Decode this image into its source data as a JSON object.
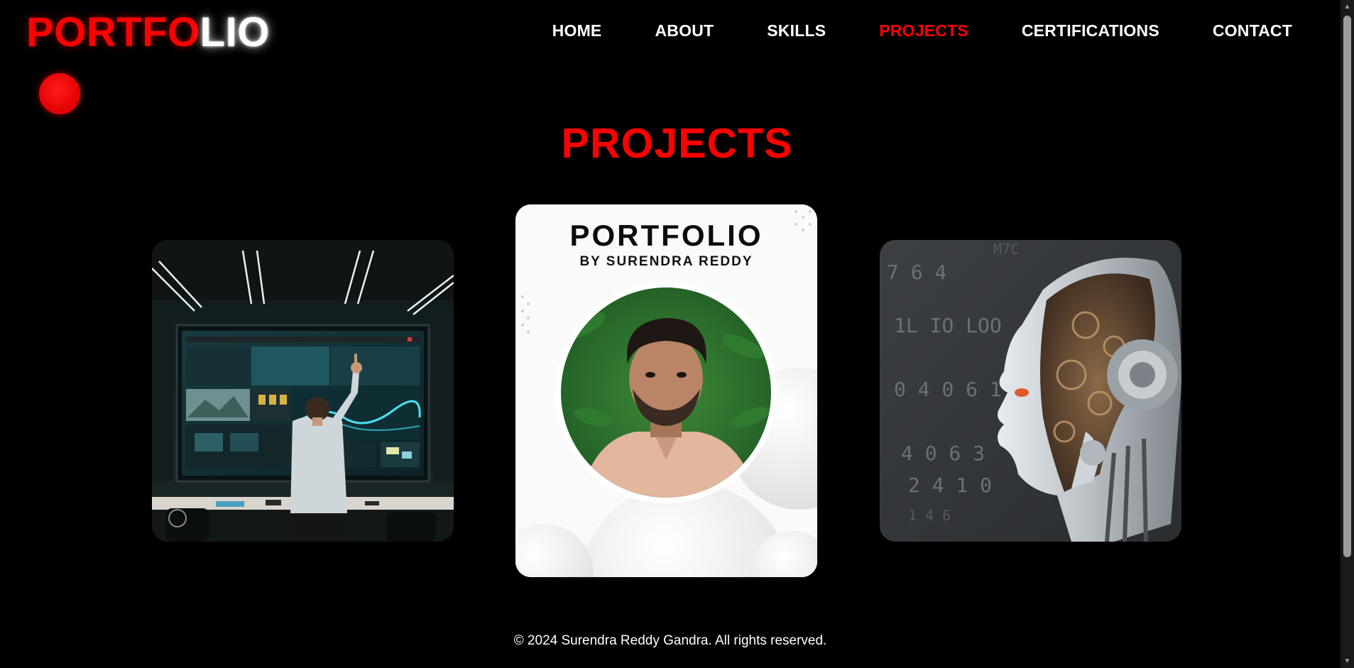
{
  "header": {
    "logo_red": "PORTFO",
    "logo_white": "LIO",
    "nav": [
      {
        "label": "HOME",
        "active": false
      },
      {
        "label": "ABOUT",
        "active": false
      },
      {
        "label": "SKILLS",
        "active": false
      },
      {
        "label": "PROJECTS",
        "active": true
      },
      {
        "label": "CERTIFICATIONS",
        "active": false
      },
      {
        "label": "CONTACT",
        "active": false
      }
    ]
  },
  "main": {
    "title": "PROJECTS",
    "cards": [
      {
        "image": "person at large analytics screen photo"
      },
      {
        "image": "portfolio cover photo",
        "title": "PORTFOLIO",
        "subtitle": "BY SURENDRA REDDY"
      },
      {
        "image": "robot head profile photo"
      }
    ]
  },
  "footer": {
    "text": "© 2024 Surendra Reddy Gandra. All rights reserved."
  },
  "colors": {
    "accent": "#ff0000",
    "background": "#000000",
    "text": "#ffffff"
  }
}
